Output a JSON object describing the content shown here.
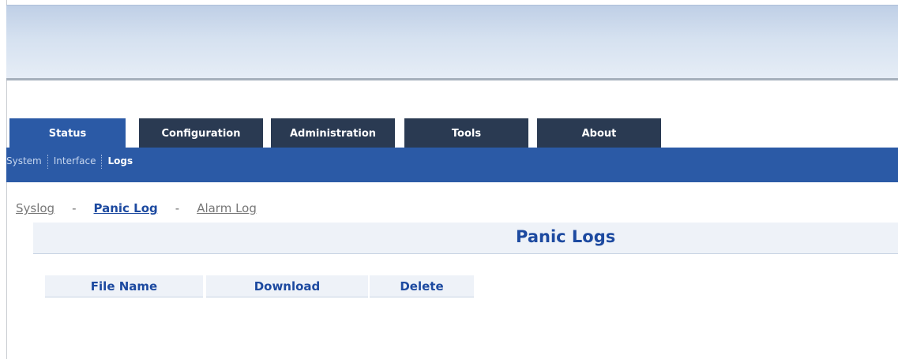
{
  "tabs": [
    {
      "label": "Status",
      "active": true
    },
    {
      "label": "Configuration",
      "active": false
    },
    {
      "label": "Administration",
      "active": false
    },
    {
      "label": "Tools",
      "active": false
    },
    {
      "label": "About",
      "active": false
    }
  ],
  "subnav": {
    "items": [
      {
        "label": "System",
        "active": false
      },
      {
        "label": "Interface",
        "active": false
      },
      {
        "label": "Logs",
        "active": true
      }
    ]
  },
  "log_links": {
    "items": [
      {
        "label": "Syslog",
        "active": false
      },
      {
        "label": "Panic Log",
        "active": true
      },
      {
        "label": "Alarm Log",
        "active": false
      }
    ],
    "separator": "-"
  },
  "section": {
    "title": "Panic Logs"
  },
  "table": {
    "columns": [
      "File Name",
      "Download",
      "Delete"
    ]
  },
  "colors": {
    "tab_dark": "#2a3a52",
    "tab_active": "#2b5aa6",
    "accent_text": "#1d4aa0",
    "header_bg": "#eef2f8"
  }
}
